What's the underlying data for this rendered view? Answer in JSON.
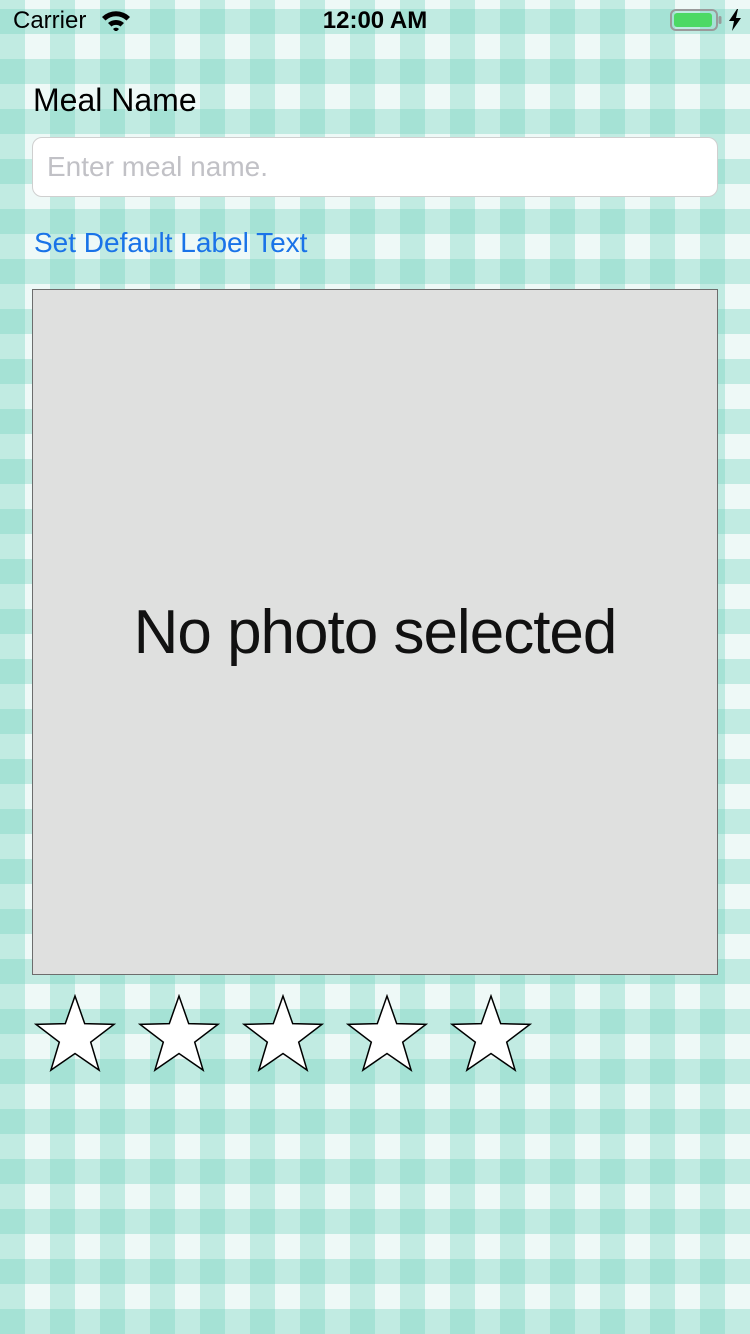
{
  "status_bar": {
    "carrier": "Carrier",
    "time": "12:00 AM",
    "icons": [
      "wifi-icon",
      "battery-icon",
      "charging-icon"
    ],
    "battery_fill_fraction": 0.95,
    "battery_color": "#4cd964"
  },
  "form": {
    "meal_name_label": "Meal Name",
    "meal_name_value": "",
    "meal_name_placeholder": "Enter meal name.",
    "default_label_button": "Set Default Label Text",
    "link_color": "#1a73e8"
  },
  "photo": {
    "placeholder_text": "No photo selected"
  },
  "rating": {
    "value": 0,
    "max": 5,
    "icon": "star-outline-icon"
  },
  "colors": {
    "background": "#eef9f7",
    "gingham": "#78d4c0",
    "photo_background": "#dfe0df"
  }
}
